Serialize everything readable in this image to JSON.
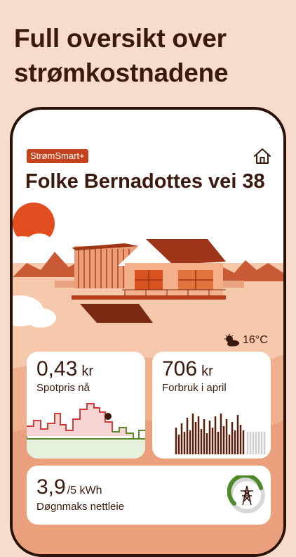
{
  "headline": {
    "line1": "Full oversikt over",
    "line2": "strømkostnadene"
  },
  "app": {
    "badge": "StrømSmart+",
    "address": "Folke Bernadottes vei 38",
    "home_icon": "home-icon"
  },
  "weather": {
    "icon": "partly-cloudy-icon",
    "temperature": "16°C"
  },
  "cards": {
    "spot": {
      "value": "0,43",
      "unit": "kr",
      "label": "Spotpris nå"
    },
    "usage": {
      "value": "706",
      "unit": "kr",
      "label": "Forbruk i april"
    },
    "grid": {
      "value": "3,9",
      "unit": "/5 kWh",
      "label": "Døgnmaks nettleie",
      "gauge_fraction": 0.78
    }
  },
  "colors": {
    "background": "#f7dccd",
    "accent": "#c4431c",
    "dark": "#3a1a0e",
    "green": "#5a8a2a",
    "price_high": "#d43a3a"
  }
}
